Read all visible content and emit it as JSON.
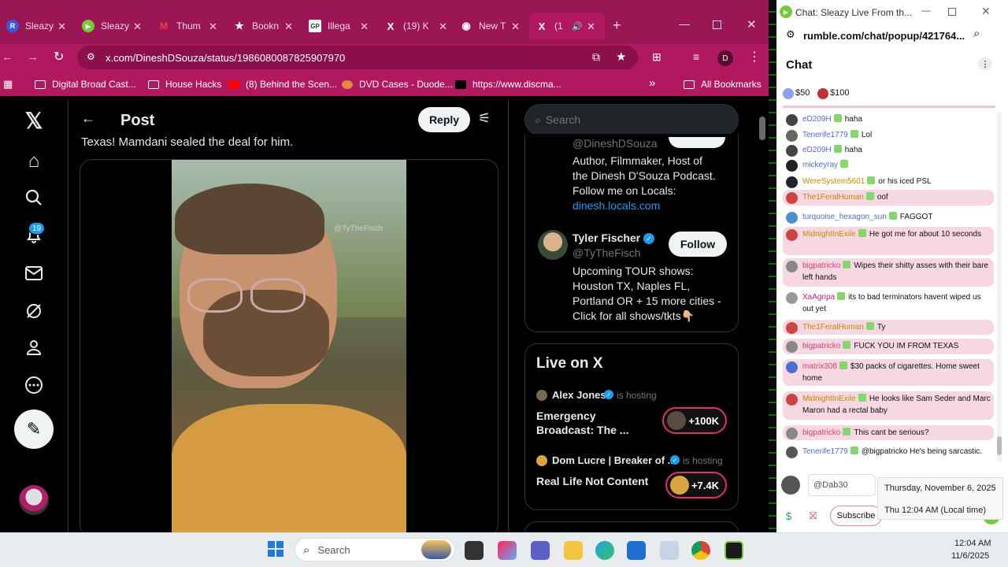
{
  "tabs": [
    {
      "label": "Sleazy",
      "fav_color": "#3d59d9",
      "fav_glyph": "R"
    },
    {
      "label": "Sleazy",
      "fav_color": "#75c93a",
      "fav_glyph": "▶"
    },
    {
      "label": "Thum",
      "fav_color": "#e94335",
      "fav_glyph": "M"
    },
    {
      "label": "Bookn",
      "fav_color": "#b0195f",
      "fav_glyph": "★"
    },
    {
      "label": "Illega",
      "fav_color": "#ffffff",
      "fav_glyph": "GP"
    },
    {
      "label": "(19) K",
      "fav_color": "#000000",
      "fav_glyph": "X"
    },
    {
      "label": "New T",
      "fav_color": "#ffffff",
      "fav_glyph": "◉"
    },
    {
      "label": "(1",
      "fav_color": "#000000",
      "fav_glyph": "X"
    }
  ],
  "address": {
    "url": "x.com/DineshDSouza/status/1986080087825907970",
    "profile_letter": "D"
  },
  "bookmarks": {
    "items": [
      {
        "label": "Digital Broad Cast..."
      },
      {
        "label": "House Hacks"
      },
      {
        "label": "(8) Behind the Scen..."
      },
      {
        "label": "DVD Cases - Duode..."
      },
      {
        "label": "https://www.discma..."
      }
    ],
    "more": "»",
    "all": "All Bookmarks"
  },
  "x": {
    "notif_count": "19",
    "post_header": "Post",
    "reply_label": "Reply",
    "tweet_text": "Texas! Mamdani sealed the deal for him.",
    "watermark": "@TyTheFisch",
    "search_placeholder": "Search",
    "profile_handle": "@DineshDSouza",
    "profile_bio_1": "Author, Filmmaker, Host of",
    "profile_bio_2": "the Dinesh D'Souza Podcast.",
    "profile_bio_3": "Follow me on Locals:",
    "profile_link": "dinesh.locals.com",
    "tyler_name": "Tyler Fischer",
    "tyler_handle": "@TyTheFisch",
    "follow_label": "Follow",
    "tyler_bio_1": "Upcoming TOUR shows:",
    "tyler_bio_2": "Houston TX, Naples FL,",
    "tyler_bio_3": "Portland OR + 15 more cities -",
    "tyler_bio_4": "Click for all shows/tkts👇🏼",
    "live_title": "Live on X",
    "live1_host": "Alex Jones",
    "live1_hosting": "is hosting",
    "live1_title": "Emergency Broadcast: The ...",
    "live1_count": "+100K",
    "live2_host": "Dom Lucre | Breaker of ...",
    "live2_hosting": "is hosting",
    "live2_title": "Real Life Not Content",
    "live2_count": "+7.4K"
  },
  "rumble": {
    "window_title": "Chat: Sleazy Live From th...",
    "url": "rumble.com/chat/popup/421764...",
    "chat_title": "Chat",
    "rant1": "$50",
    "rant2": "$100",
    "messages": [
      {
        "user": "eD209H",
        "text": "haha",
        "color": "#5a67d8",
        "pink": false
      },
      {
        "user": "Tenerife1779",
        "text": "Lol",
        "color": "#4a6fd0",
        "pink": false
      },
      {
        "user": "eD209H",
        "text": "haha",
        "color": "#5a67d8",
        "pink": false
      },
      {
        "user": "mickeyray",
        "text": "",
        "color": "#4a6fd0",
        "pink": false
      },
      {
        "user": "WereSystem5601",
        "text": "or his iced PSL",
        "color": "#c78b00",
        "pink": false
      },
      {
        "user": "The1FeralHuman",
        "text": "oof",
        "color": "#c48a00",
        "pink": true
      },
      {
        "user": "turquoise_hexagon_sun",
        "text": "FAGGOT",
        "color": "#4a6fd0",
        "pink": false
      },
      {
        "user": "MidnightInExile",
        "text": "He got me for about 10 seconds",
        "color": "#c48a00",
        "pink": true
      },
      {
        "user": "bigpatricko",
        "text": "Wipes their shitty asses with their bare left hands",
        "color": "#d0437a",
        "pink": true
      },
      {
        "user": "XaAgripa",
        "text": "its to bad terminators havent wiped us out yet",
        "color": "#c0237a",
        "pink": false
      },
      {
        "user": "The1FeralHuman",
        "text": "Ty",
        "color": "#c48a00",
        "pink": true
      },
      {
        "user": "bigpatricko",
        "text": "FUCK YOU IM FROM TEXAS",
        "color": "#d0437a",
        "pink": true
      },
      {
        "user": "matrix308",
        "text": "$30 packs of cigarettes. Home sweet home",
        "color": "#d0437a",
        "pink": true
      },
      {
        "user": "MidnightInExile",
        "text": "He looks like Sam Seder and Marc Maron had a rectal baby",
        "color": "#c48a00",
        "pink": true
      },
      {
        "user": "bigpatricko",
        "text": "This cant be serious?",
        "color": "#d0437a",
        "pink": true
      },
      {
        "user": "Tenerife1779",
        "text": "@bigpatricko He's being sarcastic.",
        "color": "#4a6fd0",
        "pink": false
      }
    ],
    "input_placeholder": "@Dab30",
    "subscribe_label": "Subscribe",
    "tooltip_date": "Thursday, November 6, 2025",
    "tooltip_time": "Thu 12:04 AM (Local time)"
  },
  "taskbar": {
    "search_placeholder": "Search",
    "clock_time": "12:04 AM",
    "clock_date": "11/6/2025"
  }
}
